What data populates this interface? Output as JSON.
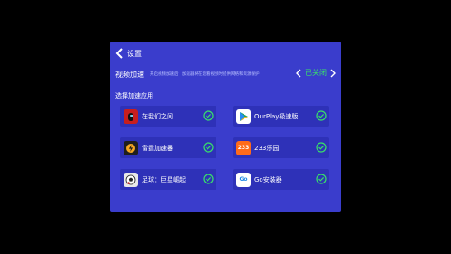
{
  "header": {
    "title": "设置"
  },
  "video_accel": {
    "label": "视频加速",
    "description": "开启视频加速后，加速器将在您看视频时提供网络和资源保护",
    "value": "已关闭"
  },
  "section": {
    "title": "选择加速应用"
  },
  "apps": [
    {
      "name": "在我们之间",
      "icon": "among-us-icon",
      "checked": true
    },
    {
      "name": "OurPlay极速版",
      "icon": "play-icon",
      "checked": true
    },
    {
      "name": "雷霆加速器",
      "icon": "thunder-icon",
      "checked": true
    },
    {
      "name": "233乐园",
      "icon": "233-icon",
      "icon_text": "233",
      "checked": true
    },
    {
      "name": "足球：巨星崛起",
      "icon": "soccer-icon",
      "checked": true
    },
    {
      "name": "Go安装器",
      "icon": "go-installer-icon",
      "icon_text": "Go",
      "checked": true
    }
  ],
  "colors": {
    "panel": "#3a3dcc",
    "tile": "#2e31b8",
    "accent_on": "#39e06a",
    "background": "#000000"
  }
}
